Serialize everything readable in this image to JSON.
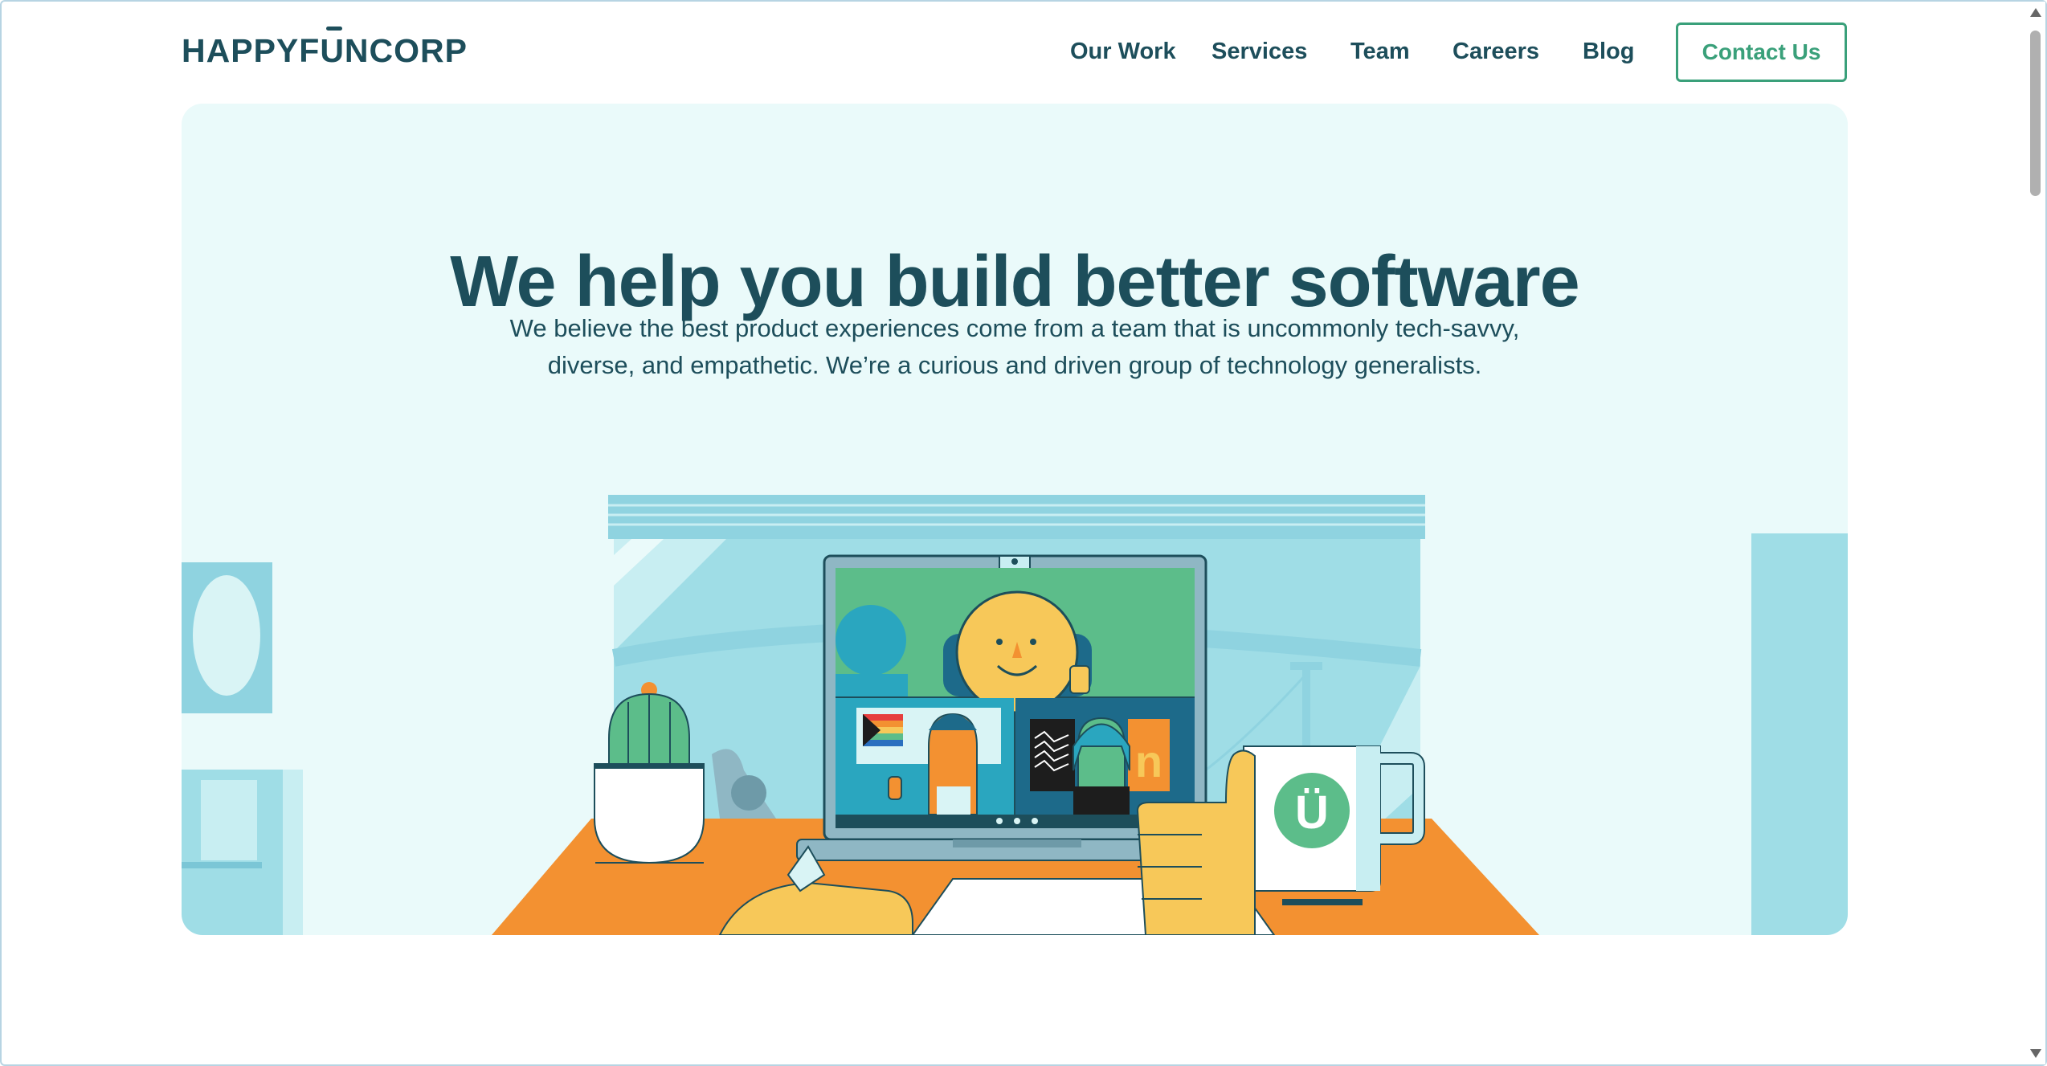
{
  "brand": {
    "logo_pre": "HAPPYF",
    "logo_u": "U",
    "logo_post": "NCORP"
  },
  "nav": {
    "our_work": "Our Work",
    "services": "Services",
    "team": "Team",
    "careers": "Careers",
    "blog": "Blog",
    "contact": "Contact Us"
  },
  "hero": {
    "headline": "We help you build better software",
    "sub_line1": "We believe the best product experiences come from a team that is uncommonly tech-savvy,",
    "sub_line2": "diverse, and empathetic. We’re a curious and driven group of technology generalists."
  },
  "illustration": {
    "mug_letter": "Ü",
    "screen_letter": "n"
  },
  "colors": {
    "brand_dark": "#1d4e5b",
    "accent_green": "#3aa07a",
    "hero_bg": "#eafafa",
    "sky_blue": "#9fdde6",
    "desk_orange": "#f39131",
    "skin_yellow": "#f7c859"
  }
}
